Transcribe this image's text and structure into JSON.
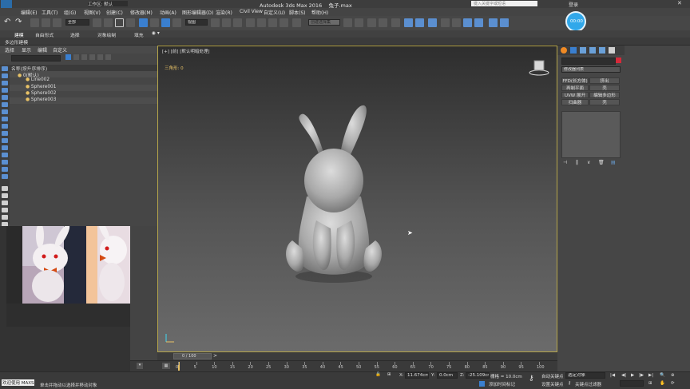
{
  "title": {
    "app_title": "Autodesk 3ds Max 2016",
    "file_name": "兔子.max",
    "workspace_label": "工作区: 默认",
    "search_placeholder": "键入关键字或短语",
    "user_label": "登录"
  },
  "menu": [
    "编辑(E)",
    "工具(T)",
    "组(G)",
    "视图(V)",
    "创建(C)",
    "修改器(M)",
    "动画(A)",
    "图形编辑器(D)",
    "渲染(R)",
    "Civil View",
    "自定义(U)",
    "脚本(S)",
    "帮助(H)"
  ],
  "toolbar": {
    "selection_filter": "全部",
    "view_dropdown": "视图",
    "named_selection_placeholder": "创建选择集",
    "timer_badge": "00:00"
  },
  "ribbon": {
    "tabs": [
      "建模",
      "自由形式",
      "选择",
      "对象绘制",
      "填充"
    ],
    "subtab": "多边形建模"
  },
  "scene_explorer": {
    "menu": [
      "选择",
      "显示",
      "编辑",
      "自定义"
    ],
    "header": "名称(按升序排序)",
    "items": [
      "0(默认)",
      "Line002",
      "Sphere001",
      "Sphere002",
      "Sphere003"
    ]
  },
  "viewport": {
    "label": "[+] [前] [默认明暗处理]",
    "stats": "三角形: 0",
    "time_slider": "0 / 100"
  },
  "command_panel": {
    "modifier_list": "修改器列表",
    "buttons": [
      [
        "FFD(长方体)",
        "挤出"
      ],
      [
        "再制平面",
        "壳"
      ],
      [
        "UVW 展开",
        "编辑多边形"
      ],
      [
        "扫曲器",
        "壳"
      ]
    ],
    "accent_color": "#d62a3a"
  },
  "timeline_ticks": [
    "0",
    "5",
    "10",
    "15",
    "20",
    "25",
    "30",
    "35",
    "40",
    "45",
    "50",
    "55",
    "60",
    "65",
    "70",
    "75",
    "80",
    "85",
    "90",
    "95",
    "100"
  ],
  "status": {
    "welcome": "欢迎使用 MAXSc",
    "prompt": "单击并拖动以选择并移动对象",
    "coord_x": "11.674cm",
    "coord_y": "0.0cm",
    "coord_z": "-25.109cm",
    "grid": "栅格 = 10.0cm",
    "add_time_tag": "添加时间标记",
    "auto_key": "自动关键点",
    "set_key": "设置关键点",
    "selected_object": "选定对象",
    "key_filter": "关键点过滤器"
  }
}
